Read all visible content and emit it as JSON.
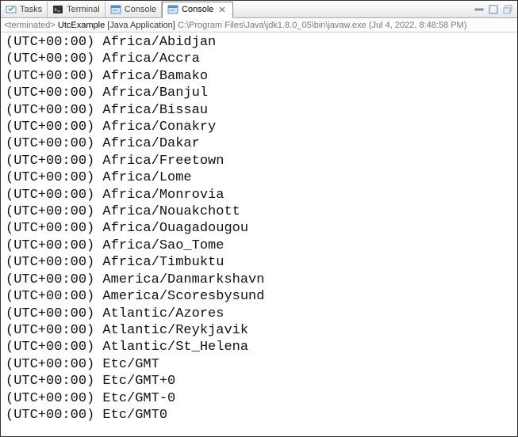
{
  "tabs": [
    {
      "label": "Tasks",
      "icon": "tasks"
    },
    {
      "label": "Terminal",
      "icon": "terminal"
    },
    {
      "label": "Console",
      "icon": "console"
    },
    {
      "label": "Console",
      "icon": "console",
      "active": true
    }
  ],
  "status": {
    "tag": "<terminated>",
    "app": "UtcExample",
    "launch": "[Java Application]",
    "path": "C:\\Program Files\\Java\\jdk1.8.0_05\\bin\\javaw.exe",
    "when": "(Jul 4, 2022, 8:48:58 PM)"
  },
  "lines": [
    "(UTC+00:00) Africa/Abidjan",
    "(UTC+00:00) Africa/Accra",
    "(UTC+00:00) Africa/Bamako",
    "(UTC+00:00) Africa/Banjul",
    "(UTC+00:00) Africa/Bissau",
    "(UTC+00:00) Africa/Conakry",
    "(UTC+00:00) Africa/Dakar",
    "(UTC+00:00) Africa/Freetown",
    "(UTC+00:00) Africa/Lome",
    "(UTC+00:00) Africa/Monrovia",
    "(UTC+00:00) Africa/Nouakchott",
    "(UTC+00:00) Africa/Ouagadougou",
    "(UTC+00:00) Africa/Sao_Tome",
    "(UTC+00:00) Africa/Timbuktu",
    "(UTC+00:00) America/Danmarkshavn",
    "(UTC+00:00) America/Scoresbysund",
    "(UTC+00:00) Atlantic/Azores",
    "(UTC+00:00) Atlantic/Reykjavik",
    "(UTC+00:00) Atlantic/St_Helena",
    "(UTC+00:00) Etc/GMT",
    "(UTC+00:00) Etc/GMT+0",
    "(UTC+00:00) Etc/GMT-0",
    "(UTC+00:00) Etc/GMT0"
  ]
}
